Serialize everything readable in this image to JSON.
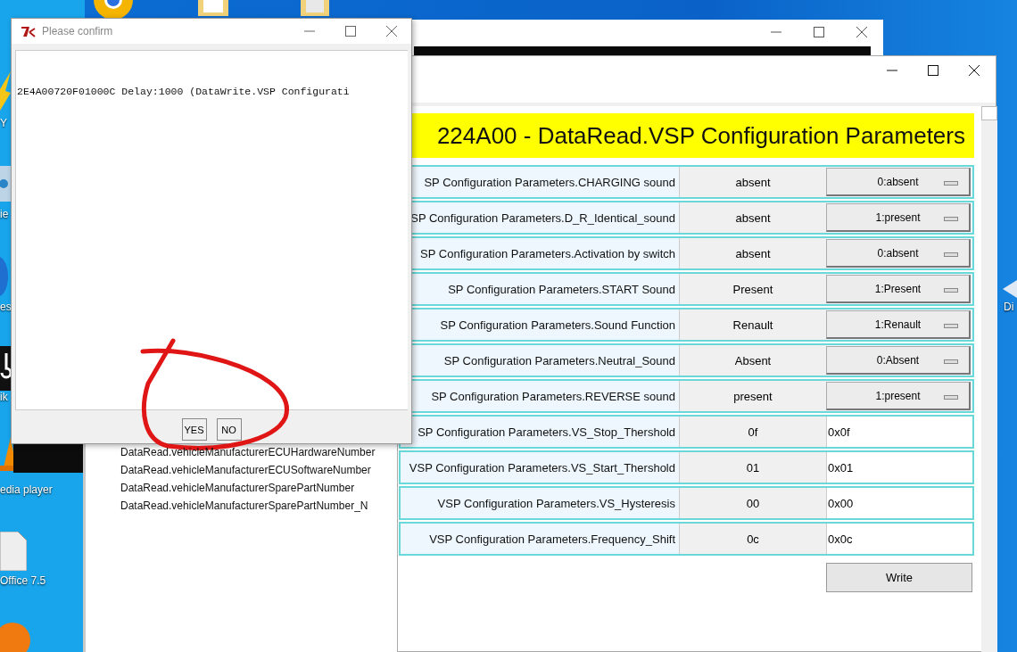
{
  "desktop": {
    "icon_labels": [
      "Y",
      "ie",
      "es",
      "ik",
      "edia player",
      "Office 7.5"
    ],
    "right_label": "Di"
  },
  "back_window": {
    "list_items": [
      "DataRead.vehicleManufacturerECUHardwareNumber",
      "DataRead.vehicleManufacturerECUSoftwareNumber",
      "DataRead.vehicleManufacturerSparePartNumber",
      "DataRead.vehicleManufacturerSparePartNumber_N"
    ]
  },
  "main_window": {
    "header": "224A00 - DataRead.VSP Configuration Parameters",
    "rows": [
      {
        "label": "SP Configuration Parameters.CHARGING sound",
        "value": "absent",
        "kind": "dropdown",
        "setting": "0:absent"
      },
      {
        "label": "SP Configuration Parameters.D_R_Identical_sound",
        "value": "absent",
        "kind": "dropdown",
        "setting": "1:present"
      },
      {
        "label": "SP Configuration Parameters.Activation by switch",
        "value": "absent",
        "kind": "dropdown",
        "setting": "0:absent"
      },
      {
        "label": "SP Configuration Parameters.START Sound",
        "value": "Present",
        "kind": "dropdown",
        "setting": "1:Present"
      },
      {
        "label": "SP Configuration Parameters.Sound Function",
        "value": "Renault",
        "kind": "dropdown",
        "setting": "1:Renault"
      },
      {
        "label": "SP Configuration Parameters.Neutral_Sound",
        "value": "Absent",
        "kind": "dropdown",
        "setting": "0:Absent"
      },
      {
        "label": "SP Configuration Parameters.REVERSE sound",
        "value": "present",
        "kind": "dropdown",
        "setting": "1:present"
      },
      {
        "label": "SP Configuration Parameters.VS_Stop_Thershold",
        "value": "0f",
        "kind": "entry",
        "setting": "0x0f"
      },
      {
        "label": "VSP Configuration Parameters.VS_Start_Thershold",
        "value": "01",
        "kind": "entry",
        "setting": "0x01"
      },
      {
        "label": "VSP Configuration Parameters.VS_Hysteresis",
        "value": "00",
        "kind": "entry",
        "setting": "0x00"
      },
      {
        "label": "VSP Configuration Parameters.Frequency_Shift",
        "value": "0c",
        "kind": "entry",
        "setting": "0x0c"
      }
    ],
    "write_button": "Write"
  },
  "dialog": {
    "title": "Please confirm",
    "message": "2E4A00720F01000C Delay:1000 (DataWrite.VSP Configurati",
    "buttons": [
      "YES",
      "NO"
    ]
  }
}
